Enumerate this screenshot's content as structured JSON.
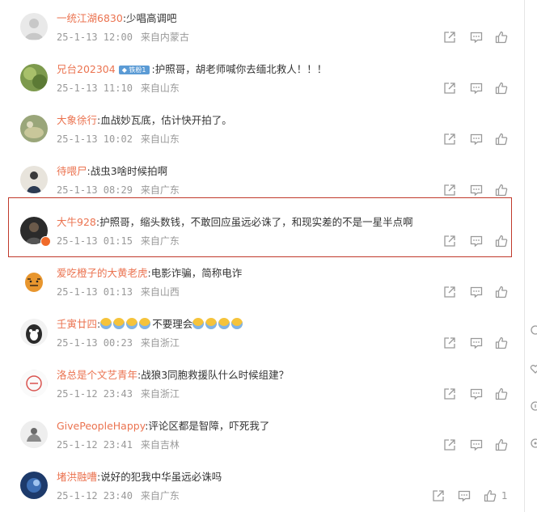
{
  "comments": [
    {
      "user": "一统江湖6830",
      "text": ":少唱高调吧",
      "time": "25-1-13 12:00",
      "loc": "来自内蒙古"
    },
    {
      "user": "兄台202304",
      "badge": "铁粉1",
      "text": ":护照哥，胡老师喊你去缅北救人！！！",
      "time": "25-1-13 11:10",
      "loc": "来自山东"
    },
    {
      "user": "大象徐行",
      "text": ":血战妙瓦底，估计快开拍了。",
      "time": "25-1-13 10:02",
      "loc": "来自山东"
    },
    {
      "user": "待喂尸",
      "text": ":战虫3啥时候拍啊",
      "time": "25-1-13 08:29",
      "loc": "来自广东"
    },
    {
      "user": "大牛928",
      "text": ":护照哥，缩头数钱，不敢回应虽远必诛了，和现实差的不是一星半点啊",
      "time": "25-1-13 01:15",
      "loc": "来自广东"
    },
    {
      "user": "爱吃橙子的大黄老虎",
      "text": ":电影诈骗，简称电诈",
      "time": "25-1-13 01:13",
      "loc": "来自山西"
    },
    {
      "user": "壬寅廿四",
      "text": ":",
      "text_after": "不要理会",
      "time": "25-1-13 00:23",
      "loc": "来自浙江"
    },
    {
      "user": "洛总是个文艺青年",
      "text": ":战狼3同胞救援队什么时候组建？",
      "time": "25-1-12 23:43",
      "loc": "来自浙江"
    },
    {
      "user": "GivePeopleHappy",
      "text": ":评论区都是智障，吓死我了",
      "time": "25-1-12 23:41",
      "loc": "来自吉林"
    },
    {
      "user": "堵洪融嘈",
      "text": ":说好的犯我中华虽远必诛吗",
      "time": "25-1-12 23:40",
      "loc": "来自广东",
      "likes": "1"
    }
  ],
  "icons": {
    "share": "share-icon",
    "comment": "comment-icon",
    "like": "like-icon"
  },
  "colors": {
    "username": "#eb7350",
    "meta": "#999999",
    "highlight": "#c0392b"
  }
}
